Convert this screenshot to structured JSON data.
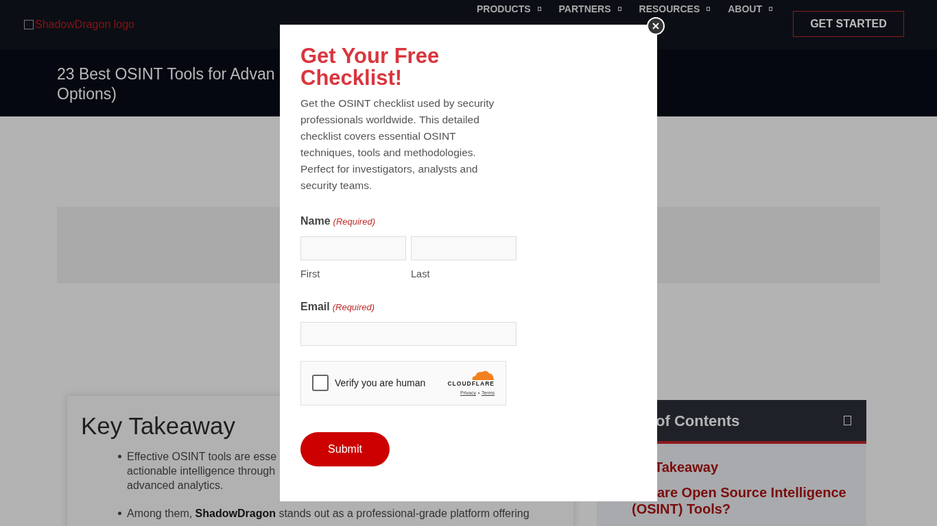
{
  "header": {
    "logo_alt": "ShadowDragon logo",
    "nav": [
      {
        "label": "PRODUCTS"
      },
      {
        "label": "PARTNERS"
      },
      {
        "label": "RESOURCES"
      },
      {
        "label": "ABOUT"
      }
    ],
    "cta": "GET STARTED"
  },
  "page_title_lines": [
    "23 Best OSINT Tools for Advan",
    "Options)"
  ],
  "key_takeaway": {
    "title": "Key Takeaway",
    "bullets": [
      [
        "Effective OSINT tools are esse",
        "actionable intelligence through",
        "advanced analytics."
      ],
      [
        "Among them, **ShadowDragon** stands out as a professional-grade platform offering"
      ]
    ]
  },
  "toc": {
    "title": "of Contents",
    "items": [
      "Takeaway",
      "are Open Source Intelligence",
      "(OSINT) Tools?"
    ]
  },
  "modal": {
    "title": "Get Your Free Checklist!",
    "description": "Get the OSINT checklist used by security professionals worldwide. This detailed checklist covers essential OSINT techniques, tools and methodologies. Perfect for investigators, analysts and security teams.",
    "fields": [
      {
        "kind": "name",
        "label": "Name",
        "required": "(Required)",
        "sublabels": [
          "First",
          "Last"
        ]
      },
      {
        "kind": "email",
        "label": "Email",
        "required": "(Required)"
      }
    ],
    "captcha": {
      "label": "Verify you are human",
      "checked": false,
      "brand": "CLOUDFLARE",
      "links": [
        "Privacy",
        "Terms"
      ]
    },
    "submit": "Submit"
  }
}
